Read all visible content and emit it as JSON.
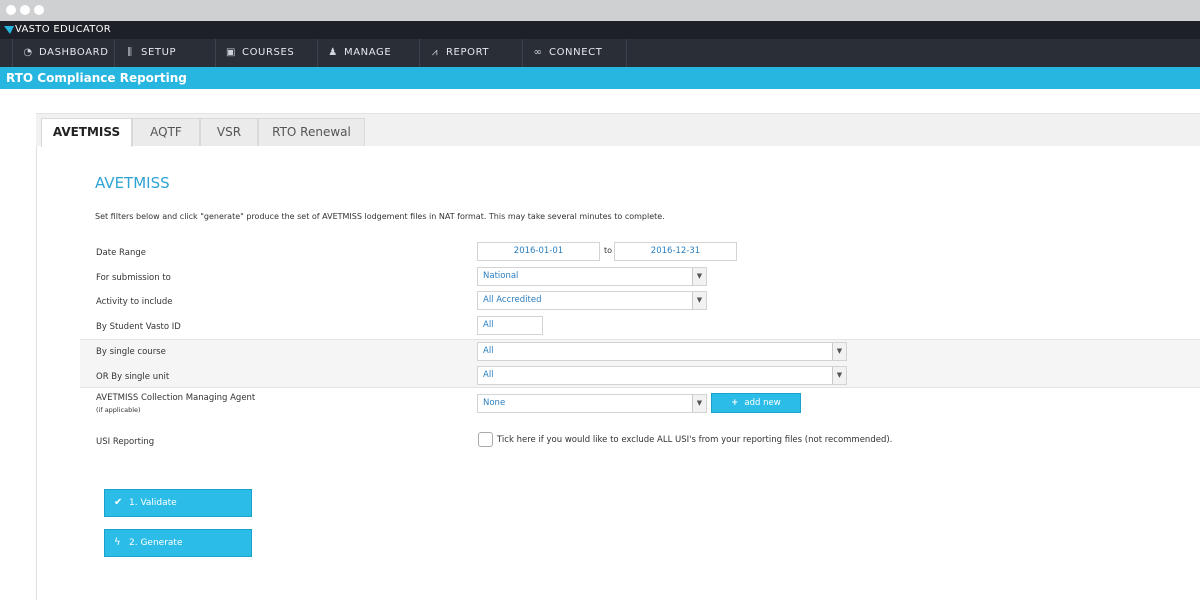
{
  "app": {
    "name": "VASTO EDUCATOR"
  },
  "nav": [
    {
      "label": "DASHBOARD",
      "icon": "dashboard-icon"
    },
    {
      "label": "SETUP",
      "icon": "sliders-icon"
    },
    {
      "label": "COURSES",
      "icon": "calendar-icon"
    },
    {
      "label": "MANAGE",
      "icon": "users-icon"
    },
    {
      "label": "REPORT",
      "icon": "chart-icon"
    },
    {
      "label": "CONNECT",
      "icon": "link-icon"
    }
  ],
  "page": {
    "title": "RTO Compliance Reporting"
  },
  "tabs": [
    "AVETMISS",
    "AQTF",
    "VSR",
    "RTO Renewal"
  ],
  "active_tab": "AVETMISS",
  "section": {
    "heading": "AVETMISS",
    "description": "Set filters below and click \"generate\" produce the set of AVETMISS lodgement files in NAT format. This may take several minutes to complete."
  },
  "form": {
    "date_range": {
      "label": "Date Range",
      "from": "2016-01-01",
      "to_label": "to",
      "to": "2016-12-31"
    },
    "submission": {
      "label": "For submission to",
      "value": "National"
    },
    "activity": {
      "label": "Activity to include",
      "value": "All Accredited"
    },
    "student": {
      "label": "By Student Vasto ID",
      "value": "All"
    },
    "course": {
      "label": "By single course",
      "value": "All"
    },
    "unit": {
      "label": "OR By single unit",
      "value": "All"
    },
    "agent": {
      "label": "AVETMISS Collection Managing Agent",
      "sublabel": "(if applicable)",
      "value": "None",
      "add_label": "add new"
    },
    "usi": {
      "label": "USI Reporting",
      "checkbox_text": "Tick here if you would like to exclude ALL USI's from your reporting files (not recommended).",
      "checked": false
    }
  },
  "actions": {
    "validate": "1. Validate",
    "generate": "2. Generate"
  },
  "colors": {
    "accent": "#26b6e0",
    "nav_bg": "#2a2e36",
    "heading": "#2ea3d4"
  }
}
